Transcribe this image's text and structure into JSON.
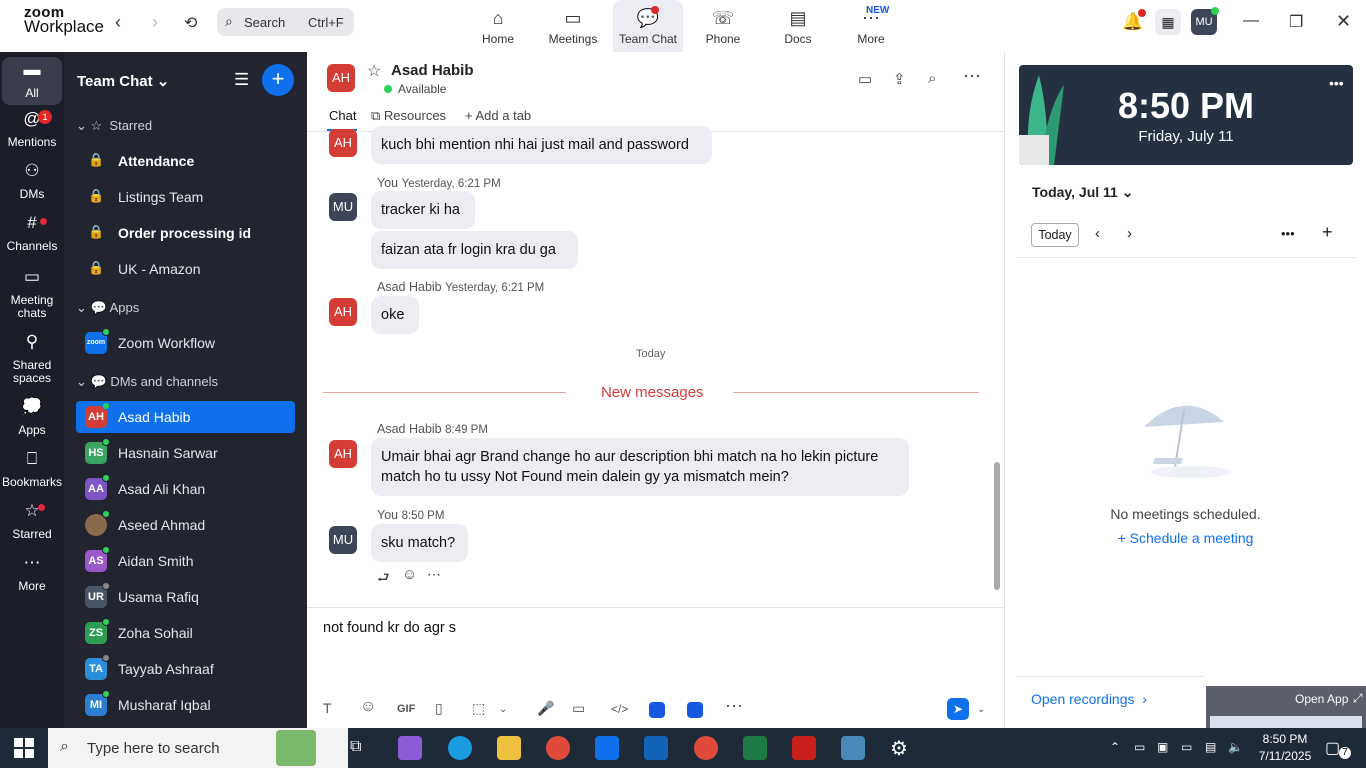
{
  "topbar": {
    "logo_line1": "zoom",
    "logo_line2": "Workplace",
    "search_placeholder": "Search",
    "search_shortcut": "Ctrl+F",
    "tabs": [
      {
        "label": "Home",
        "icon": "house-icon"
      },
      {
        "label": "Meetings",
        "icon": "video-icon"
      },
      {
        "label": "Team Chat",
        "icon": "chat-icon"
      },
      {
        "label": "Phone",
        "icon": "phone-icon"
      },
      {
        "label": "Docs",
        "icon": "doc-icon"
      },
      {
        "label": "More",
        "icon": "more-icon"
      }
    ],
    "new_badge": "NEW",
    "avatar": "MU"
  },
  "rail": [
    {
      "label": "All"
    },
    {
      "label": "Mentions",
      "badge": "1"
    },
    {
      "label": "DMs"
    },
    {
      "label": "Channels"
    },
    {
      "label": "Meeting chats"
    },
    {
      "label": "Shared spaces"
    },
    {
      "label": "Apps"
    },
    {
      "label": "Bookmarks"
    },
    {
      "label": "Starred"
    },
    {
      "label": "More"
    }
  ],
  "sidebar": {
    "header": "Team Chat",
    "starred_label": "Starred",
    "starred": [
      {
        "label": "Attendance",
        "bold": true
      },
      {
        "label": "Listings Team",
        "bold": false
      },
      {
        "label": "Order processing id",
        "bold": true
      },
      {
        "label": "UK - Amazon",
        "bold": false
      }
    ],
    "apps_label": "Apps",
    "app_item": "Zoom Workflow",
    "app_icon_text": "zoom",
    "dms_label": "DMs and channels",
    "dms": [
      {
        "initials": "AH",
        "name": "Asad Habib",
        "color": "#d33d35"
      },
      {
        "initials": "HS",
        "name": "Hasnain Sarwar",
        "color": "#3aa560"
      },
      {
        "initials": "AA",
        "name": "Asad Ali Khan",
        "color": "#7d55c7"
      },
      {
        "initials": "",
        "name": "Aseed Ahmad",
        "color": "#8a6a4a"
      },
      {
        "initials": "AS",
        "name": "Aidan Smith",
        "color": "#9a58c8"
      },
      {
        "initials": "UR",
        "name": "Usama Rafiq",
        "color": "#4a5568"
      },
      {
        "initials": "ZS",
        "name": "Zoha Sohail",
        "color": "#2e9d54"
      },
      {
        "initials": "TA",
        "name": "Tayyab Ashraaf",
        "color": "#2a8fd8"
      },
      {
        "initials": "MI",
        "name": "Musharaf Iqbal",
        "color": "#2a7fd0"
      }
    ]
  },
  "chat": {
    "avatar": "AH",
    "name": "Asad Habib",
    "status": "Available",
    "tabs": {
      "chat": "Chat",
      "resources": "Resources",
      "add": "Add a tab"
    },
    "m0": "kuch bhi mention nhi hai just mail and password",
    "m1_sender": "You",
    "m1_time": "Yesterday, 6:21 PM",
    "m1a": "tracker ki ha",
    "m1b": "faizan ata fr login kra du ga",
    "m2_sender": "Asad Habib",
    "m2_time": "Yesterday, 6:21 PM",
    "m2": "oke",
    "day_divider": "Today",
    "new_messages": "New messages",
    "m3_sender": "Asad Habib",
    "m3_time": "8:49 PM",
    "m3_line1": "Umair bhai agr Brand change ho aur description bhi match na ho lekin picture",
    "m3_line2": "match ho tu ussy Not Found mein dalein gy ya mismatch mein?",
    "m4_sender": "You",
    "m4_time": "8:50 PM",
    "m4": "sku match?",
    "avatar_me": "MU",
    "composer_text": "not found kr do agr s"
  },
  "right": {
    "time": "8:50 PM",
    "date": "Friday, July 11",
    "today_label": "Today, Jul 11",
    "today_btn": "Today",
    "no_meetings": "No meetings scheduled.",
    "schedule": "Schedule a meeting",
    "open_recordings": "Open recordings",
    "open_app": "Open App"
  },
  "taskbar": {
    "search": "Type here to search",
    "time": "8:50 PM",
    "date": "7/11/2025",
    "notif": "7"
  }
}
